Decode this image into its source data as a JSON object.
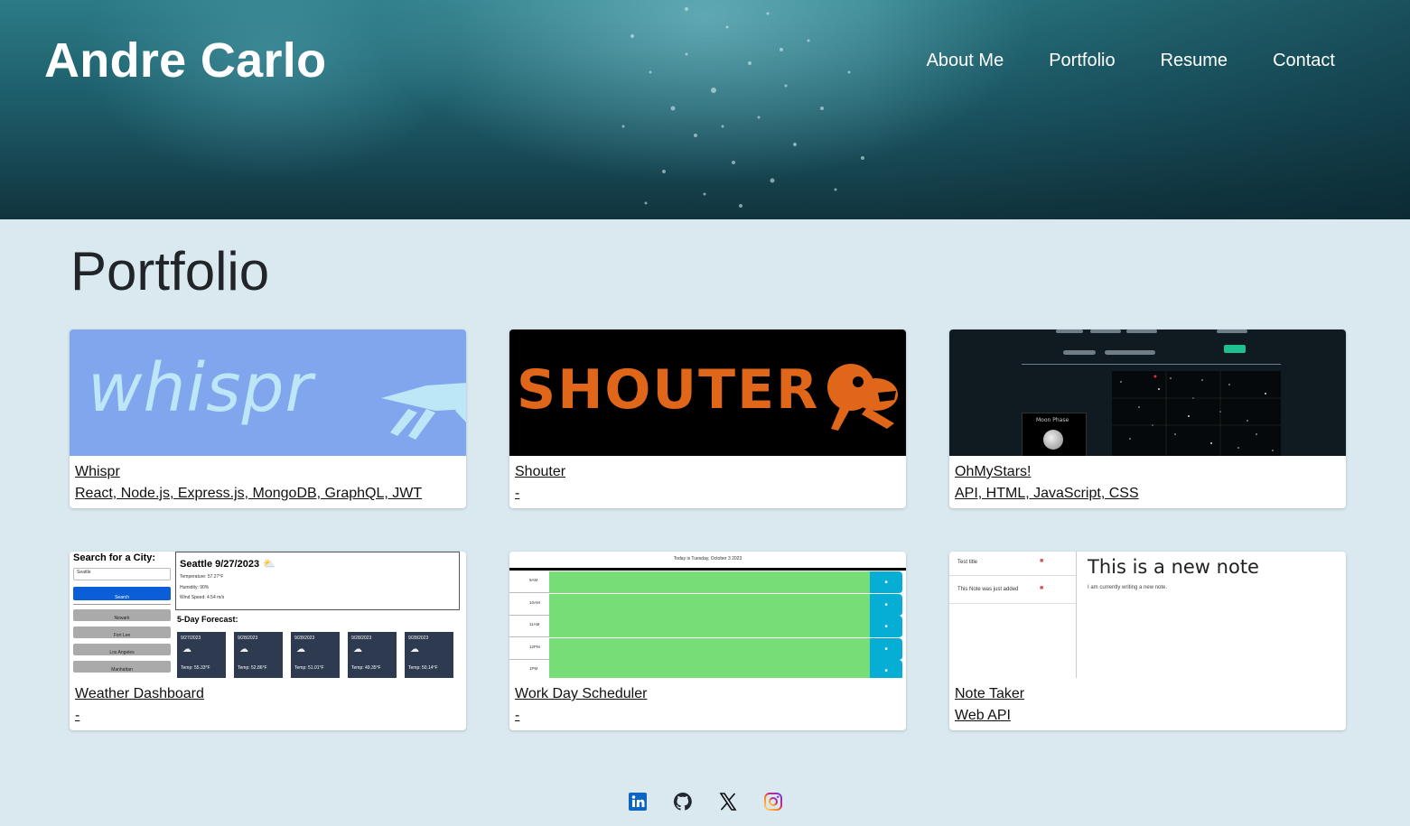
{
  "header": {
    "site_title": "Andre Carlo",
    "nav": [
      {
        "label": "About Me"
      },
      {
        "label": "Portfolio"
      },
      {
        "label": "Resume"
      },
      {
        "label": "Contact"
      }
    ]
  },
  "main": {
    "heading": "Portfolio",
    "projects": [
      {
        "name": "Whispr",
        "tech": "React, Node.js, Express.js, MongoDB, GraphQL, JWT",
        "thumb_text": "whispr"
      },
      {
        "name": "Shouter",
        "tech": "-",
        "thumb_text": "SHOUTER"
      },
      {
        "name": "OhMyStars!",
        "tech": "API, HTML, JavaScript, CSS",
        "thumb_text": "Moon Phase"
      },
      {
        "name": "Weather Dashboard",
        "tech": "-",
        "thumb_search": "Search for a City:",
        "thumb_input": "Seattle",
        "thumb_button": "Search",
        "thumb_cities": [
          "Newark",
          "Fort Lee",
          "Los Angeles",
          "Manhattan"
        ],
        "thumb_city": "Seattle 9/27/2023",
        "thumb_stats": [
          "Temperature: 57.27°F",
          "Humidity: 90%",
          "Wind Speed: 4.54 m/s"
        ],
        "thumb_forecast": "5-Day Forecast:",
        "thumb_days": [
          "9/27/2023",
          "9/28/2023",
          "9/28/2023",
          "9/28/2023",
          "9/28/2023"
        ],
        "thumb_temps": [
          "Temp: 55.33°F",
          "Temp: 52.86°F",
          "Temp: 51.01°F",
          "Temp: 49.35°F",
          "Temp: 50.14°F"
        ]
      },
      {
        "name": "Work Day Scheduler",
        "tech": "-",
        "thumb_date": "Today is Tuesday, October 3 2023",
        "thumb_hours": [
          "9AM",
          "10AM",
          "11AM",
          "12PM",
          "1PM"
        ]
      },
      {
        "name": "Note Taker",
        "tech": "Web API",
        "thumb_notes": [
          "Test title",
          "This Note was just added"
        ],
        "thumb_title": "This is a new note",
        "thumb_body": "I am currently writing a new note."
      }
    ]
  },
  "footer": {
    "icons": [
      "linkedin-icon",
      "github-icon",
      "x-icon",
      "instagram-icon"
    ]
  },
  "colors": {
    "page_bg": "#dae8f0",
    "whispr_bg": "#81a6ee",
    "shouter_orange": "#e0661a",
    "scheduler_green": "#77dd77",
    "scheduler_blue": "#06aed5"
  }
}
